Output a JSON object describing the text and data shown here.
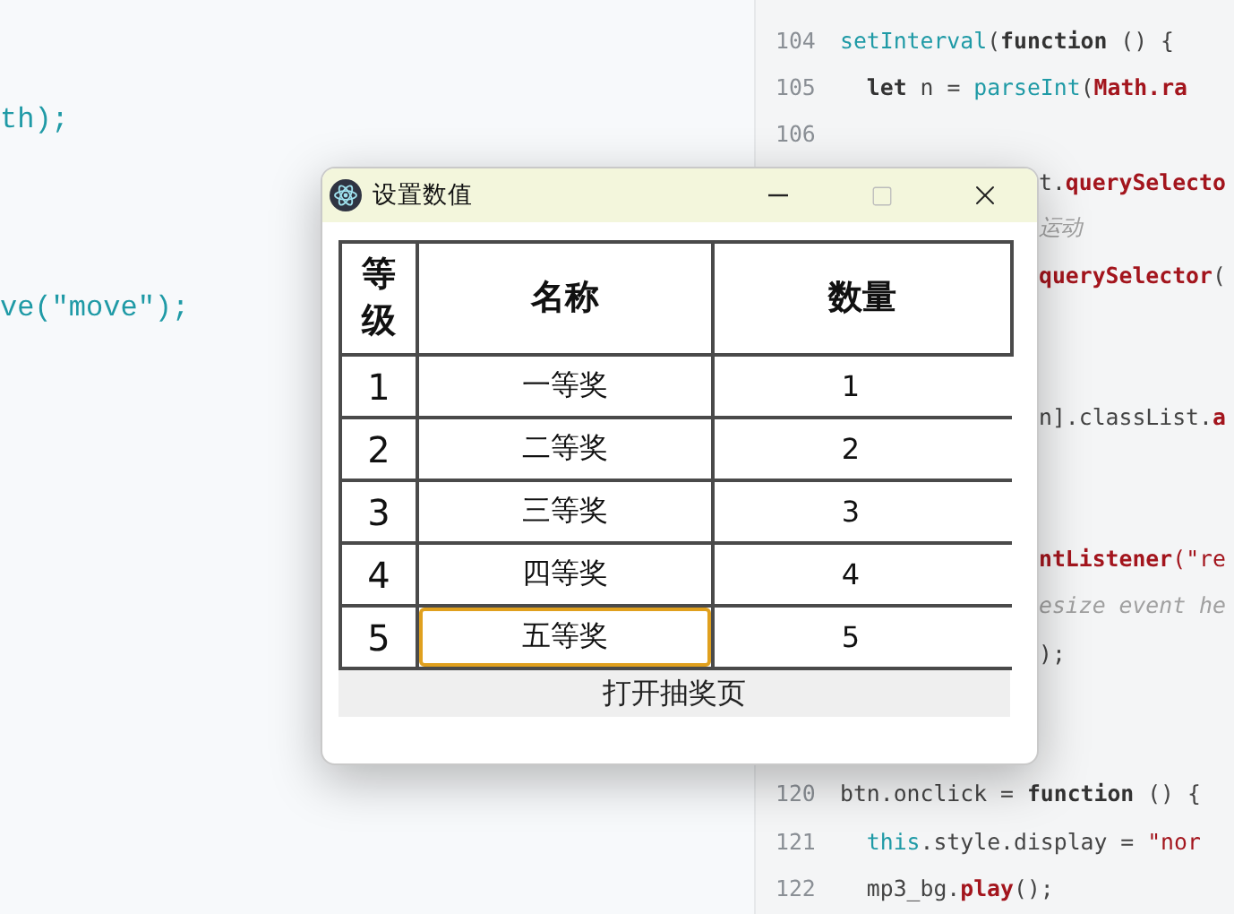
{
  "editor": {
    "left_lines": [
      {
        "kind": "code",
        "tokens": [
          {
            "text": "th);",
            "kind": "func"
          }
        ]
      },
      {
        "kind": "blank"
      },
      {
        "kind": "blank"
      },
      {
        "kind": "blank"
      },
      {
        "kind": "code",
        "tokens": [
          {
            "text": "ve(\"move\");",
            "kind": "func"
          }
        ]
      }
    ],
    "right_lines": [
      {
        "kind": "full",
        "number": "104",
        "tokens": [
          {
            "text": "setInterval",
            "kind": "func"
          },
          {
            "text": "(",
            "kind": "plain"
          },
          {
            "text": "function",
            "kind": "keyword"
          },
          {
            "text": " () {",
            "kind": "plain"
          }
        ]
      },
      {
        "kind": "full",
        "number": "105",
        "tokens": [
          {
            "text": "  let",
            "kind": "keyword"
          },
          {
            "text": " n = ",
            "kind": "plain"
          },
          {
            "text": "parseInt",
            "kind": "func"
          },
          {
            "text": "(",
            "kind": "plain"
          },
          {
            "text": "Math.ra",
            "kind": "name"
          }
        ]
      },
      {
        "kind": "full",
        "number": "106"
      },
      {
        "kind": "behind",
        "tokens": [
          {
            "text": "t.",
            "kind": "plain"
          },
          {
            "text": "querySelecto",
            "kind": "name"
          }
        ]
      },
      {
        "kind": "behind",
        "tokens": [
          {
            "text": "运动",
            "kind": "comment"
          }
        ]
      },
      {
        "kind": "behind",
        "tokens": [
          {
            "text": "querySelector",
            "kind": "name"
          },
          {
            "text": "(",
            "kind": "plain"
          }
        ]
      },
      {
        "kind": "blank"
      },
      {
        "kind": "blank"
      },
      {
        "kind": "behind",
        "tokens": [
          {
            "text": "n].classList.",
            "kind": "plain"
          },
          {
            "text": "a",
            "kind": "name"
          }
        ]
      },
      {
        "kind": "blank"
      },
      {
        "kind": "blank"
      },
      {
        "kind": "behind",
        "tokens": [
          {
            "text": "ntListener",
            "kind": "name"
          },
          {
            "text": "(\"re",
            "kind": "string"
          }
        ]
      },
      {
        "kind": "behind",
        "tokens": [
          {
            "text": "esize event he",
            "kind": "comment"
          }
        ]
      },
      {
        "kind": "behind",
        "tokens": [
          {
            "text": ");",
            "kind": "plain"
          }
        ]
      },
      {
        "kind": "blank"
      },
      {
        "kind": "blank"
      },
      {
        "kind": "full",
        "number": "120",
        "tokens": [
          {
            "text": "btn.onclick = ",
            "kind": "plain"
          },
          {
            "text": "function",
            "kind": "keyword"
          },
          {
            "text": " () {",
            "kind": "plain"
          }
        ]
      },
      {
        "kind": "full",
        "number": "121",
        "tokens": [
          {
            "text": "  this",
            "kind": "func"
          },
          {
            "text": ".style.display = ",
            "kind": "plain"
          },
          {
            "text": "\"nor",
            "kind": "string"
          }
        ]
      },
      {
        "kind": "full",
        "number": "122",
        "tokens": [
          {
            "text": "  mp3_bg.",
            "kind": "plain"
          },
          {
            "text": "play",
            "kind": "name"
          },
          {
            "text": "();",
            "kind": "plain"
          }
        ]
      }
    ]
  },
  "window": {
    "title": "设置数值",
    "table": {
      "columns": [
        "等级",
        "名称",
        "数量"
      ],
      "rows": [
        {
          "grade": "1",
          "name": "一等奖",
          "count": "1",
          "focused": false
        },
        {
          "grade": "2",
          "name": "二等奖",
          "count": "2",
          "focused": false
        },
        {
          "grade": "3",
          "name": "三等奖",
          "count": "3",
          "focused": false
        },
        {
          "grade": "4",
          "name": "四等奖",
          "count": "4",
          "focused": false
        },
        {
          "grade": "5",
          "name": "五等奖",
          "count": "5",
          "focused": true
        }
      ]
    },
    "button": "打开抽奖页"
  }
}
